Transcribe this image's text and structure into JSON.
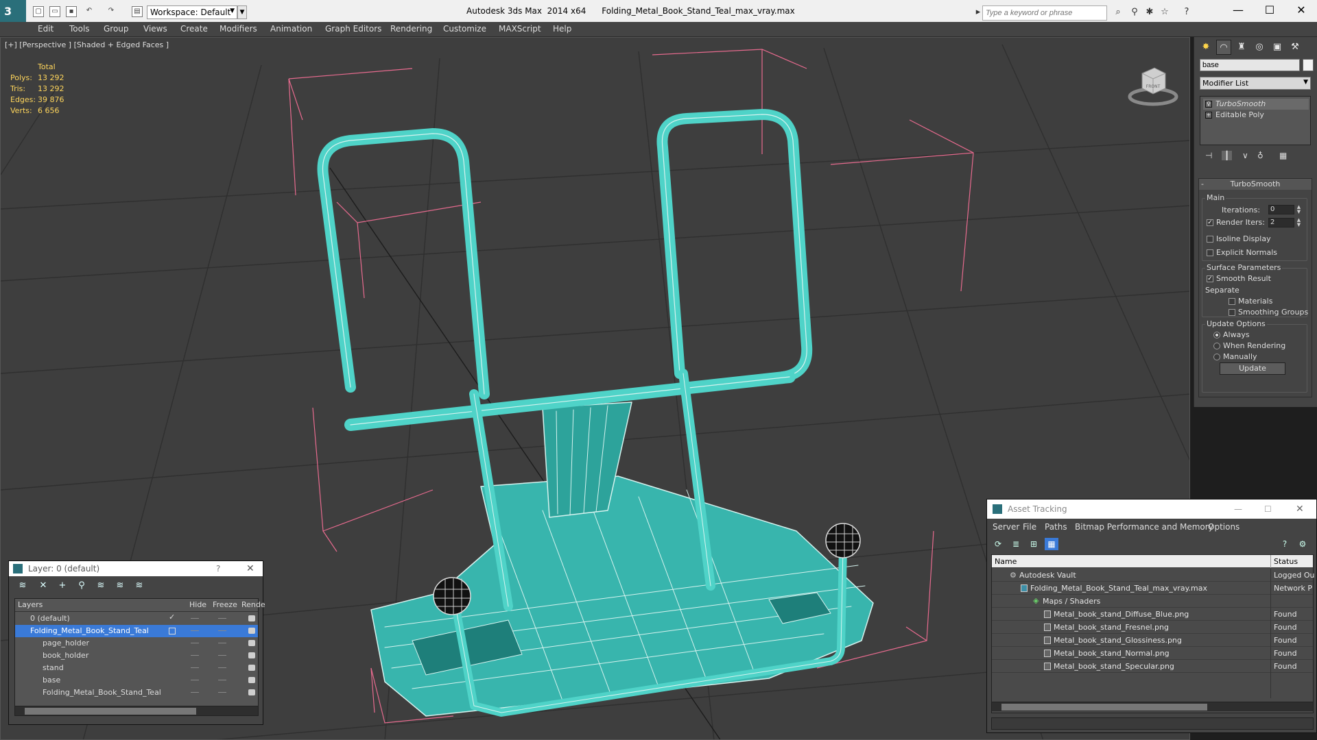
{
  "titlebar": {
    "workspace_label": "Workspace: Default",
    "app_name": "Autodesk 3ds Max  2014 x64",
    "file_name": "Folding_Metal_Book_Stand_Teal_max_vray.max",
    "search_placeholder": "Type a keyword or phrase"
  },
  "menu": [
    "Edit",
    "Tools",
    "Group",
    "Views",
    "Create",
    "Modifiers",
    "Animation",
    "Graph Editors",
    "Rendering",
    "Customize",
    "MAXScript",
    "Help"
  ],
  "viewport": {
    "label": "[+] [Perspective ] [Shaded + Edged Faces ]",
    "stats": {
      "header": "Total",
      "rows": [
        {
          "key": "Polys:",
          "value": "13 292"
        },
        {
          "key": "Tris:",
          "value": "13 292"
        },
        {
          "key": "Edges:",
          "value": "39 876"
        },
        {
          "key": "Verts:",
          "value": "6 656"
        }
      ]
    },
    "viewcube_face": "FRONT",
    "colors": {
      "background": "#3e3e3e",
      "grid": "#2e2e2e",
      "mesh": "#4fd3c8",
      "wire": "#cfeeea",
      "bbox": "#e86b8f"
    }
  },
  "command_panel": {
    "object_name": "base",
    "modifier_list_label": "Modifier List",
    "stack": [
      "TurboSmooth",
      "Editable Poly"
    ],
    "rollout_title": "TurboSmooth",
    "main_group": "Main",
    "iterations_label": "Iterations:",
    "iterations_value": "0",
    "render_iters_label": "Render Iters:",
    "render_iters_value": "2",
    "isoline_label": "Isoline Display",
    "explicit_normals_label": "Explicit Normals",
    "surface_group": "Surface Parameters",
    "smooth_result_label": "Smooth Result",
    "separate_label": "Separate",
    "materials_label": "Materials",
    "smoothing_groups_label": "Smoothing Groups",
    "update_group": "Update Options",
    "opt_always": "Always",
    "opt_rendering": "When Rendering",
    "opt_manually": "Manually",
    "update_button": "Update"
  },
  "layer_window": {
    "title": "Layer: 0 (default)",
    "col_layers": "Layers",
    "col_hide": "Hide",
    "col_freeze": "Freeze",
    "col_render": "Rende",
    "rows": [
      {
        "name": "0 (default)"
      },
      {
        "name": "Folding_Metal_Book_Stand_Teal"
      },
      {
        "name": "page_holder"
      },
      {
        "name": "book_holder"
      },
      {
        "name": "stand"
      },
      {
        "name": "base"
      },
      {
        "name": "Folding_Metal_Book_Stand_Teal"
      }
    ]
  },
  "asset_tracking": {
    "title": "Asset Tracking",
    "menu": [
      "Server",
      "File",
      "Paths",
      "Bitmap Performance and Memory",
      "Options"
    ],
    "col_name": "Name",
    "col_status": "Status",
    "rows": [
      {
        "name": "Autodesk Vault",
        "status": "Logged Ou"
      },
      {
        "name": "Folding_Metal_Book_Stand_Teal_max_vray.max",
        "status": "Network P"
      },
      {
        "name": "Maps / Shaders",
        "status": ""
      },
      {
        "name": "Metal_book_stand_Diffuse_Blue.png",
        "status": "Found"
      },
      {
        "name": "Metal_book_stand_Fresnel.png",
        "status": "Found"
      },
      {
        "name": "Metal_book_stand_Glossiness.png",
        "status": "Found"
      },
      {
        "name": "Metal_book_stand_Normal.png",
        "status": "Found"
      },
      {
        "name": "Metal_book_stand_Specular.png",
        "status": "Found"
      }
    ]
  }
}
